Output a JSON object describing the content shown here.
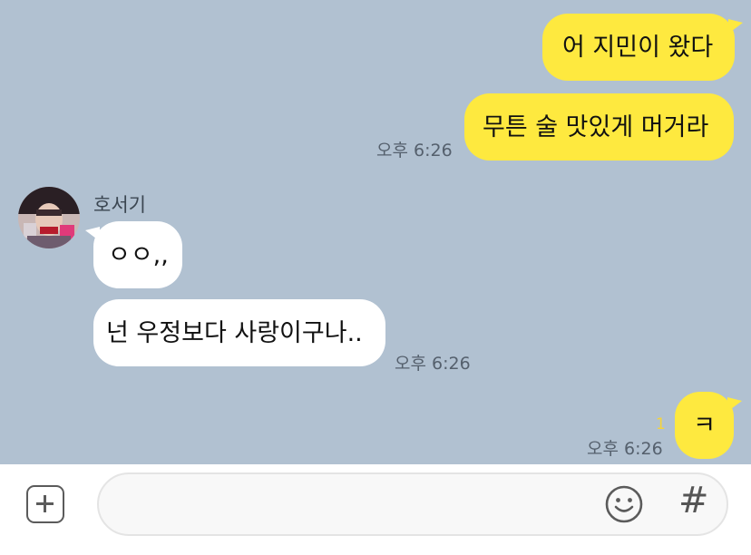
{
  "messages": {
    "m1": {
      "text": "어 지민이 왔다"
    },
    "m2": {
      "text": "무튼 술 맛있게 머거라",
      "time": "오후 6:26"
    },
    "m3": {
      "sender": "호서기",
      "text": "ㅇㅇ,,"
    },
    "m4": {
      "text": "넌 우정보다 사랑이구나..",
      "time": "오후 6:26"
    },
    "m5": {
      "text": "ㅋ",
      "time": "오후 6:26",
      "unread": "1"
    }
  },
  "input": {
    "placeholder": ""
  },
  "icons": {
    "attach": "plus-square-icon",
    "emoji": "smiley-icon",
    "hashtag": "hash-icon"
  },
  "colors": {
    "chat_bg": "#b1c1d1",
    "my_bubble": "#fee93f",
    "their_bubble": "#ffffff",
    "unread": "#f5d43b"
  }
}
